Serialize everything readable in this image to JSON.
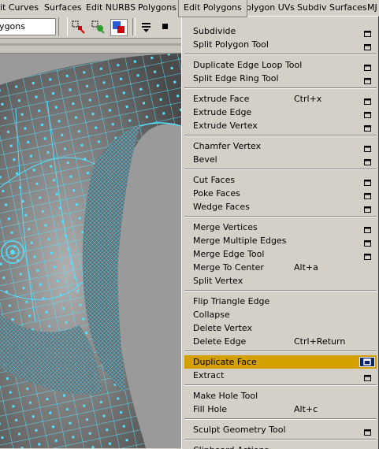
{
  "menubar": {
    "items": [
      "it Curves",
      "Surfaces",
      "Edit NURBS",
      "Polygons",
      "Edit Polygons",
      "Polygon UVs",
      "Subdiv Surfaces",
      "MJ"
    ],
    "active": "Edit Polygons"
  },
  "toolbar": {
    "mode_value": "lygons"
  },
  "dropdown": {
    "items": [
      {
        "label": "Subdivide",
        "shortcut": "",
        "option": true
      },
      {
        "label": "Split Polygon Tool",
        "shortcut": "",
        "option": true
      },
      {
        "label": "Duplicate Edge Loop Tool",
        "shortcut": "",
        "option": true
      },
      {
        "label": "Split Edge Ring Tool",
        "shortcut": "",
        "option": true
      },
      {
        "label": "Extrude Face",
        "shortcut": "Ctrl+x",
        "option": true
      },
      {
        "label": "Extrude Edge",
        "shortcut": "",
        "option": true
      },
      {
        "label": "Extrude Vertex",
        "shortcut": "",
        "option": true
      },
      {
        "label": "Chamfer Vertex",
        "shortcut": "",
        "option": true
      },
      {
        "label": "Bevel",
        "shortcut": "",
        "option": true
      },
      {
        "label": "Cut Faces",
        "shortcut": "",
        "option": true
      },
      {
        "label": "Poke Faces",
        "shortcut": "",
        "option": true
      },
      {
        "label": "Wedge Faces",
        "shortcut": "",
        "option": true
      },
      {
        "label": "Merge Vertices",
        "shortcut": "",
        "option": true
      },
      {
        "label": "Merge Multiple Edges",
        "shortcut": "",
        "option": true
      },
      {
        "label": "Merge Edge Tool",
        "shortcut": "",
        "option": true
      },
      {
        "label": "Merge To Center",
        "shortcut": "Alt+a",
        "option": false
      },
      {
        "label": "Split Vertex",
        "shortcut": "",
        "option": false
      },
      {
        "label": "Flip Triangle Edge",
        "shortcut": "",
        "option": false
      },
      {
        "label": "Collapse",
        "shortcut": "",
        "option": false
      },
      {
        "label": "Delete Vertex",
        "shortcut": "",
        "option": false
      },
      {
        "label": "Delete Edge",
        "shortcut": "Ctrl+Return",
        "option": false
      },
      {
        "label": "Duplicate Face",
        "shortcut": "",
        "option": true,
        "highlighted": true
      },
      {
        "label": "Extract",
        "shortcut": "",
        "option": true
      },
      {
        "label": "Make Hole Tool",
        "shortcut": "",
        "option": false
      },
      {
        "label": "Fill Hole",
        "shortcut": "Alt+c",
        "option": false
      },
      {
        "label": "Sculpt Geometry Tool",
        "shortcut": "",
        "option": true
      },
      {
        "label": "Clipboard Actions",
        "shortcut": "",
        "option": false
      }
    ]
  },
  "colors": {
    "menu_bg": "#d4d0c8",
    "highlight": "#d4a000",
    "wire": "#55e0ff",
    "mesh_shade": "#8a8a8a"
  },
  "icons": [
    "selection-mask-icon",
    "hierarchy-mode-icon",
    "object-mode-icon",
    "component-mode-icon",
    "shelf-menu-icon",
    "stop-icon"
  ]
}
